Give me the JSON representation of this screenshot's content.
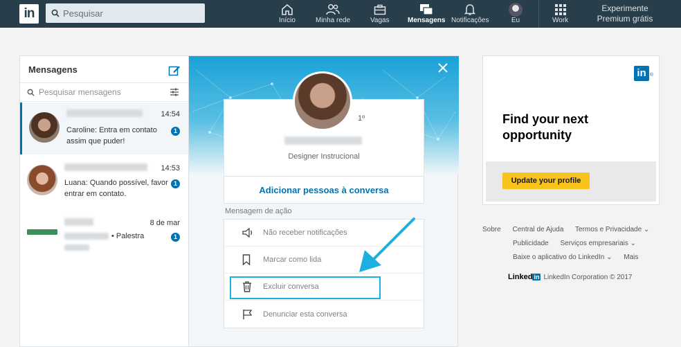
{
  "nav": {
    "logo": "in",
    "search_placeholder": "Pesquisar",
    "items": [
      {
        "label": "Início",
        "icon": "home-icon"
      },
      {
        "label": "Minha rede",
        "icon": "network-icon"
      },
      {
        "label": "Vagas",
        "icon": "briefcase-icon"
      },
      {
        "label": "Mensagens",
        "icon": "messages-icon",
        "active": true
      },
      {
        "label": "Notificações",
        "icon": "bell-icon"
      },
      {
        "label": "Eu",
        "icon": "avatar-icon"
      },
      {
        "label": "Work",
        "icon": "grid-icon"
      }
    ],
    "premium_line1": "Experimente",
    "premium_line2": "Premium grátis"
  },
  "messages": {
    "title": "Mensagens",
    "search_placeholder": "Pesquisar mensagens",
    "conversations": [
      {
        "time": "14:54",
        "preview": "Caroline: Entra em contato assim que puder!",
        "unread": "1"
      },
      {
        "time": "14:53",
        "preview": "Luana: Quando possível, favor entrar em contato.",
        "unread": "1"
      },
      {
        "time": "8 de mar",
        "preview": "• Palestra",
        "unread": "1"
      }
    ]
  },
  "detail": {
    "degree": "1º",
    "job_title": "Designer Instrucional",
    "add_people": "Adicionar pessoas à conversa",
    "section_label": "Mensagem de ação",
    "actions": [
      {
        "label": "Não receber notificações",
        "icon": "mute-icon"
      },
      {
        "label": "Marcar como lida",
        "icon": "bookmark-icon"
      },
      {
        "label": "Excluir conversa",
        "icon": "trash-icon"
      },
      {
        "label": "Denunciar esta conversa",
        "icon": "flag-icon"
      }
    ]
  },
  "ad": {
    "logo": "in",
    "reg": "®",
    "headline": "Find your next opportunity",
    "button": "Update your profile"
  },
  "footer": {
    "row1": [
      "Sobre",
      "Central de Ajuda",
      "Termos e Privacidade ⌄"
    ],
    "row2": [
      "Publicidade",
      "Serviços empresariais ⌄"
    ],
    "row3": [
      "Baixe o aplicativo do LinkedIn ⌄",
      "Mais"
    ],
    "brand_word": "Linked",
    "brand_box": "in",
    "copyright": "LinkedIn Corporation © 2017"
  },
  "colors": {
    "nav_bg": "#283e4a",
    "accent": "#0073b1",
    "ad_button": "#f8c41b",
    "highlight": "#1cb0e0"
  }
}
